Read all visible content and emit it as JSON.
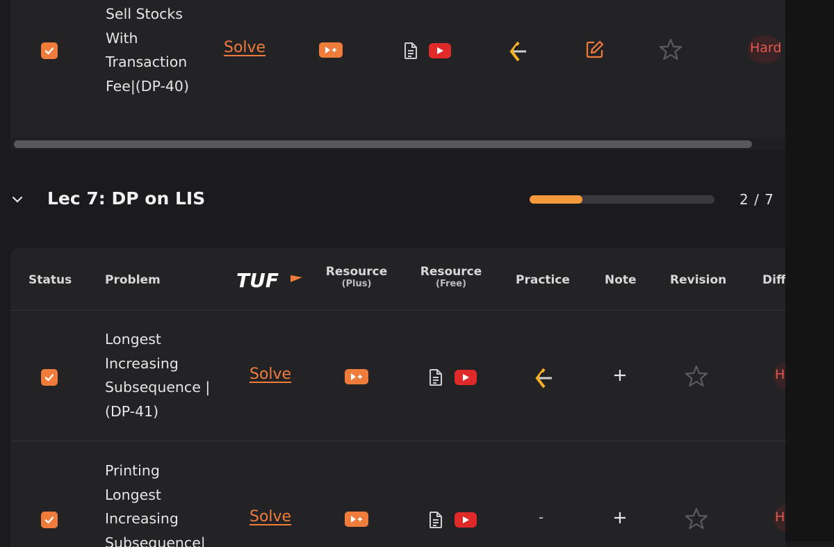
{
  "top_row": {
    "checked": true,
    "title": "Sell Stocks With Transaction Fee|(DP-40)",
    "solve_label": "Solve",
    "difficulty": "Hard"
  },
  "section": {
    "title": "Lec 7: DP on LIS",
    "progress_text": "2 / 7",
    "progress_fraction": 0.2857,
    "accent": "#f59a3c"
  },
  "table_header": {
    "status": "Status",
    "problem": "Problem",
    "tuf_logo": "TUF",
    "resource_plus": "Resource",
    "resource_plus_sub": "(Plus)",
    "resource_free": "Resource",
    "resource_free_sub": "(Free)",
    "practice": "Practice",
    "note": "Note",
    "revision": "Revision",
    "difficulty": "Diff"
  },
  "rows": [
    {
      "checked": true,
      "title": "Longest Increasing Subsequence | (DP-41)",
      "solve_label": "Solve",
      "practice_placeholder": "",
      "note_symbol": "+",
      "difficulty": "H"
    },
    {
      "checked": true,
      "title": "Printing Longest Increasing Subsequence|",
      "solve_label": "Solve",
      "practice_placeholder": "-",
      "note_symbol": "+",
      "difficulty": "H"
    }
  ],
  "colors": {
    "orange": "#f07c3c",
    "youtube_red": "#e02a2a",
    "hard_red": "#e8574f",
    "background": "#1b1b1d",
    "card": "#232325"
  },
  "icons": [
    "checkbox-icon",
    "play-plus-icon",
    "article-icon",
    "youtube-icon",
    "codestudio-icon",
    "edit-note-icon",
    "star-icon",
    "plus-icon",
    "chevron-down-icon"
  ]
}
